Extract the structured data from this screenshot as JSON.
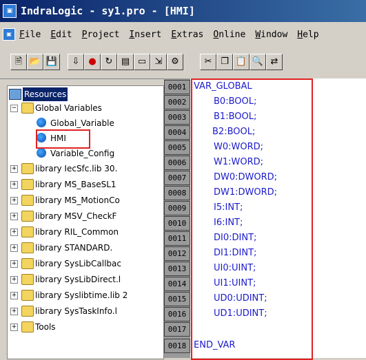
{
  "title": "IndraLogic - sy1.pro - [HMI]",
  "menu": [
    "File",
    "Edit",
    "Project",
    "Insert",
    "Extras",
    "Online",
    "Window",
    "Help"
  ],
  "toolbar_icons": [
    "new-icon",
    "open-icon",
    "save-icon",
    "build-icon",
    "stop-icon",
    "connect-icon",
    "settings-icon",
    "monitor-icon",
    "download-icon",
    "login-icon",
    "cut-icon",
    "copy-icon",
    "paste-icon",
    "find-icon",
    "replace-icon"
  ],
  "tree": {
    "root": "Resources",
    "global_vars": "Global Variables",
    "gv_items": [
      "Global_Variable",
      "HMI",
      "Variable_Config"
    ],
    "libraries": [
      "library IecSfc.lib 30.",
      "library MS_BaseSL1",
      "library MS_MotionCo",
      "library MSV_CheckF",
      "library RIL_Common",
      "library STANDARD.",
      "library SysLibCallbac",
      "library SysLibDirect.l",
      "library Syslibtime.lib 2",
      "library SysTaskInfo.l"
    ],
    "tools": "Tools"
  },
  "code": {
    "line_numbers": [
      "0001",
      "0002",
      "0003",
      "0004",
      "0005",
      "0006",
      "0007",
      "0008",
      "0009",
      "0010",
      "0011",
      "0012",
      "0013",
      "0014",
      "0015",
      "0016",
      "0017",
      "0018"
    ],
    "lines": [
      {
        "name": "VAR_GLOBAL",
        "type": ""
      },
      {
        "name": "B0",
        "type": "BOOL"
      },
      {
        "name": "B1",
        "type": "BOOL"
      },
      {
        "name": "B2",
        "type": "BOOL"
      },
      {
        "name": "W0",
        "type": "WORD"
      },
      {
        "name": "W1",
        "type": "WORD"
      },
      {
        "name": "DW0",
        "type": "DWORD"
      },
      {
        "name": "DW1",
        "type": "DWORD"
      },
      {
        "name": "I5",
        "type": "INT"
      },
      {
        "name": "I6",
        "type": "INT"
      },
      {
        "name": "DI0",
        "type": "DINT"
      },
      {
        "name": "DI1",
        "type": "DINT"
      },
      {
        "name": "UI0",
        "type": "UINT"
      },
      {
        "name": "UI1",
        "type": "UINT"
      },
      {
        "name": "UD0",
        "type": "UDINT"
      },
      {
        "name": "UD1",
        "type": "UDINT"
      },
      {
        "name": "",
        "type": ""
      },
      {
        "name": "END_VAR",
        "type": ""
      }
    ]
  }
}
